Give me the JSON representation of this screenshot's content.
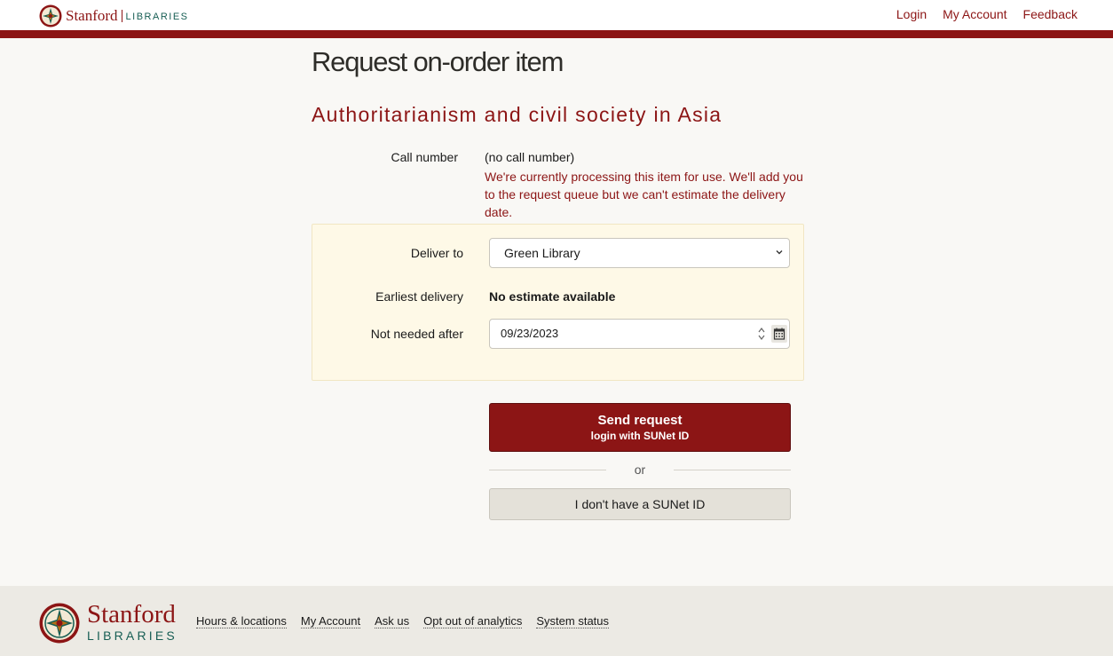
{
  "header": {
    "brand_name": "Stanford",
    "brand_sub": "LIBRARIES",
    "nav": [
      "Login",
      "My Account",
      "Feedback"
    ]
  },
  "main": {
    "page_title": "Request on-order item",
    "item_title": "Authoritarianism and civil society in Asia",
    "call_number_label": "Call number",
    "call_number_value": "(no call number)",
    "call_note": "We're currently processing this item for use. We'll add you to the request queue but we can't estimate the delivery date.",
    "deliver_to_label": "Deliver to",
    "deliver_to_value": "Green Library",
    "earliest_label": "Earliest delivery",
    "earliest_value": "No estimate available",
    "not_needed_label": "Not needed after",
    "not_needed_value": "09/23/2023",
    "send_label": "Send request",
    "send_sub": "login with SUNet ID",
    "or_text": "or",
    "no_sunet_label": "I don't have a SUNet ID"
  },
  "footer": {
    "brand_name": "Stanford",
    "brand_sub": "LIBRARIES",
    "links": [
      "Hours & locations",
      "My Account",
      "Ask us",
      "Opt out of analytics",
      "System status"
    ]
  },
  "colors": {
    "cardinal": "#8c1515",
    "panel_bg": "#fef9e7",
    "palo_alto_green": "#175e54"
  }
}
